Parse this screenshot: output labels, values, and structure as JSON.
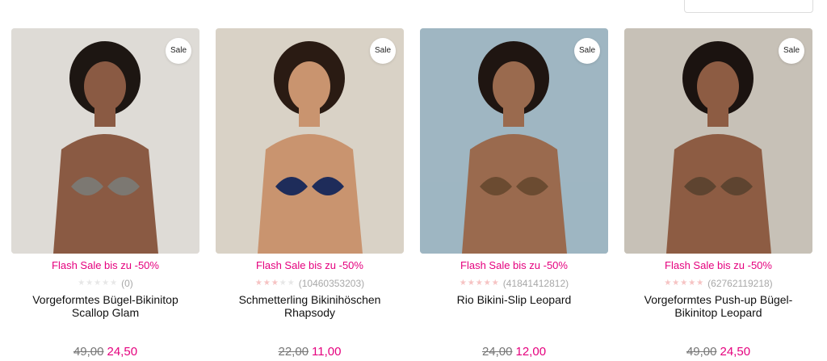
{
  "products": [
    {
      "badge": "Sale",
      "promo": "Flash Sale bis zu -50%",
      "stars": 0,
      "review_count": "(0)",
      "title": "Vorgeformtes Bügel-Bikinitop Scallop Glam",
      "old_price": "49,00",
      "new_price": "24,50",
      "colors": {
        "bg": "#dedbd6",
        "skin": "#8a5a43",
        "suit": "#7c7872",
        "hair": "#1d1612"
      }
    },
    {
      "badge": "Sale",
      "promo": "Flash Sale bis zu -50%",
      "stars": 3,
      "review_count": "(10460353203)",
      "title": "Schmetterling Bikinihöschen Rhapsody",
      "old_price": "22,00",
      "new_price": "11,00",
      "colors": {
        "bg": "#d9d2c6",
        "skin": "#c9946f",
        "suit": "#1e2c5a",
        "hair": "#2a1b13"
      }
    },
    {
      "badge": "Sale",
      "promo": "Flash Sale bis zu -50%",
      "stars": 5,
      "review_count": "(41841412812)",
      "title": "Rio Bikini-Slip Leopard",
      "old_price": "24,00",
      "new_price": "12,00",
      "colors": {
        "bg": "#9fb6c2",
        "skin": "#9a6a4e",
        "suit": "#6b4b31",
        "hair": "#1f1511"
      }
    },
    {
      "badge": "Sale",
      "promo": "Flash Sale bis zu -50%",
      "stars": 5,
      "review_count": "(62762119218)",
      "title": "Vorgeformtes Push-up Bügel-Bikinitop Leopard",
      "old_price": "49,00",
      "new_price": "24,50",
      "colors": {
        "bg": "#c7c1b7",
        "skin": "#8d5c43",
        "suit": "#5e4430",
        "hair": "#1b1310"
      }
    }
  ]
}
